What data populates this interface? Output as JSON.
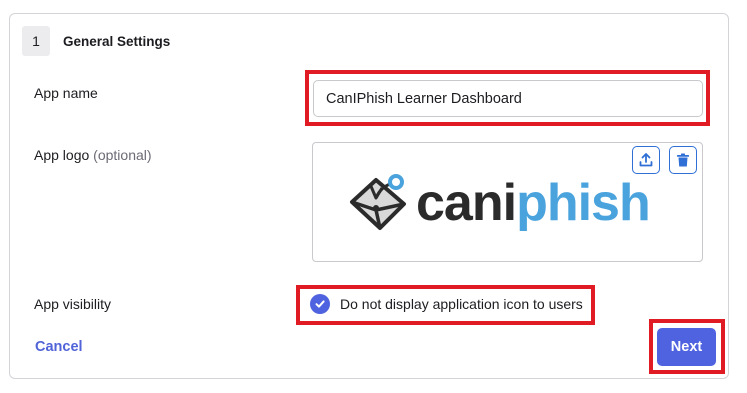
{
  "section": {
    "step_number": "1",
    "title": "General Settings"
  },
  "fields": {
    "app_name_label": "App name",
    "app_name_value": "CanIPhish Learner Dashboard",
    "app_logo_label": "App logo",
    "app_logo_optional": "(optional)",
    "logo_wordmark_dark": "cani",
    "logo_wordmark_blue": "phish",
    "app_visibility_label": "App visibility",
    "visibility_checkbox_label": "Do not display application icon to users",
    "visibility_checkbox_checked": true
  },
  "actions": {
    "cancel_label": "Cancel",
    "next_label": "Next"
  },
  "icons": {
    "upload": "upload-icon",
    "delete": "trash-icon",
    "check": "check-icon"
  },
  "colors": {
    "accent": "#4f63e0",
    "highlight": "#e01b24",
    "logo_blue": "#4aa3dd"
  }
}
